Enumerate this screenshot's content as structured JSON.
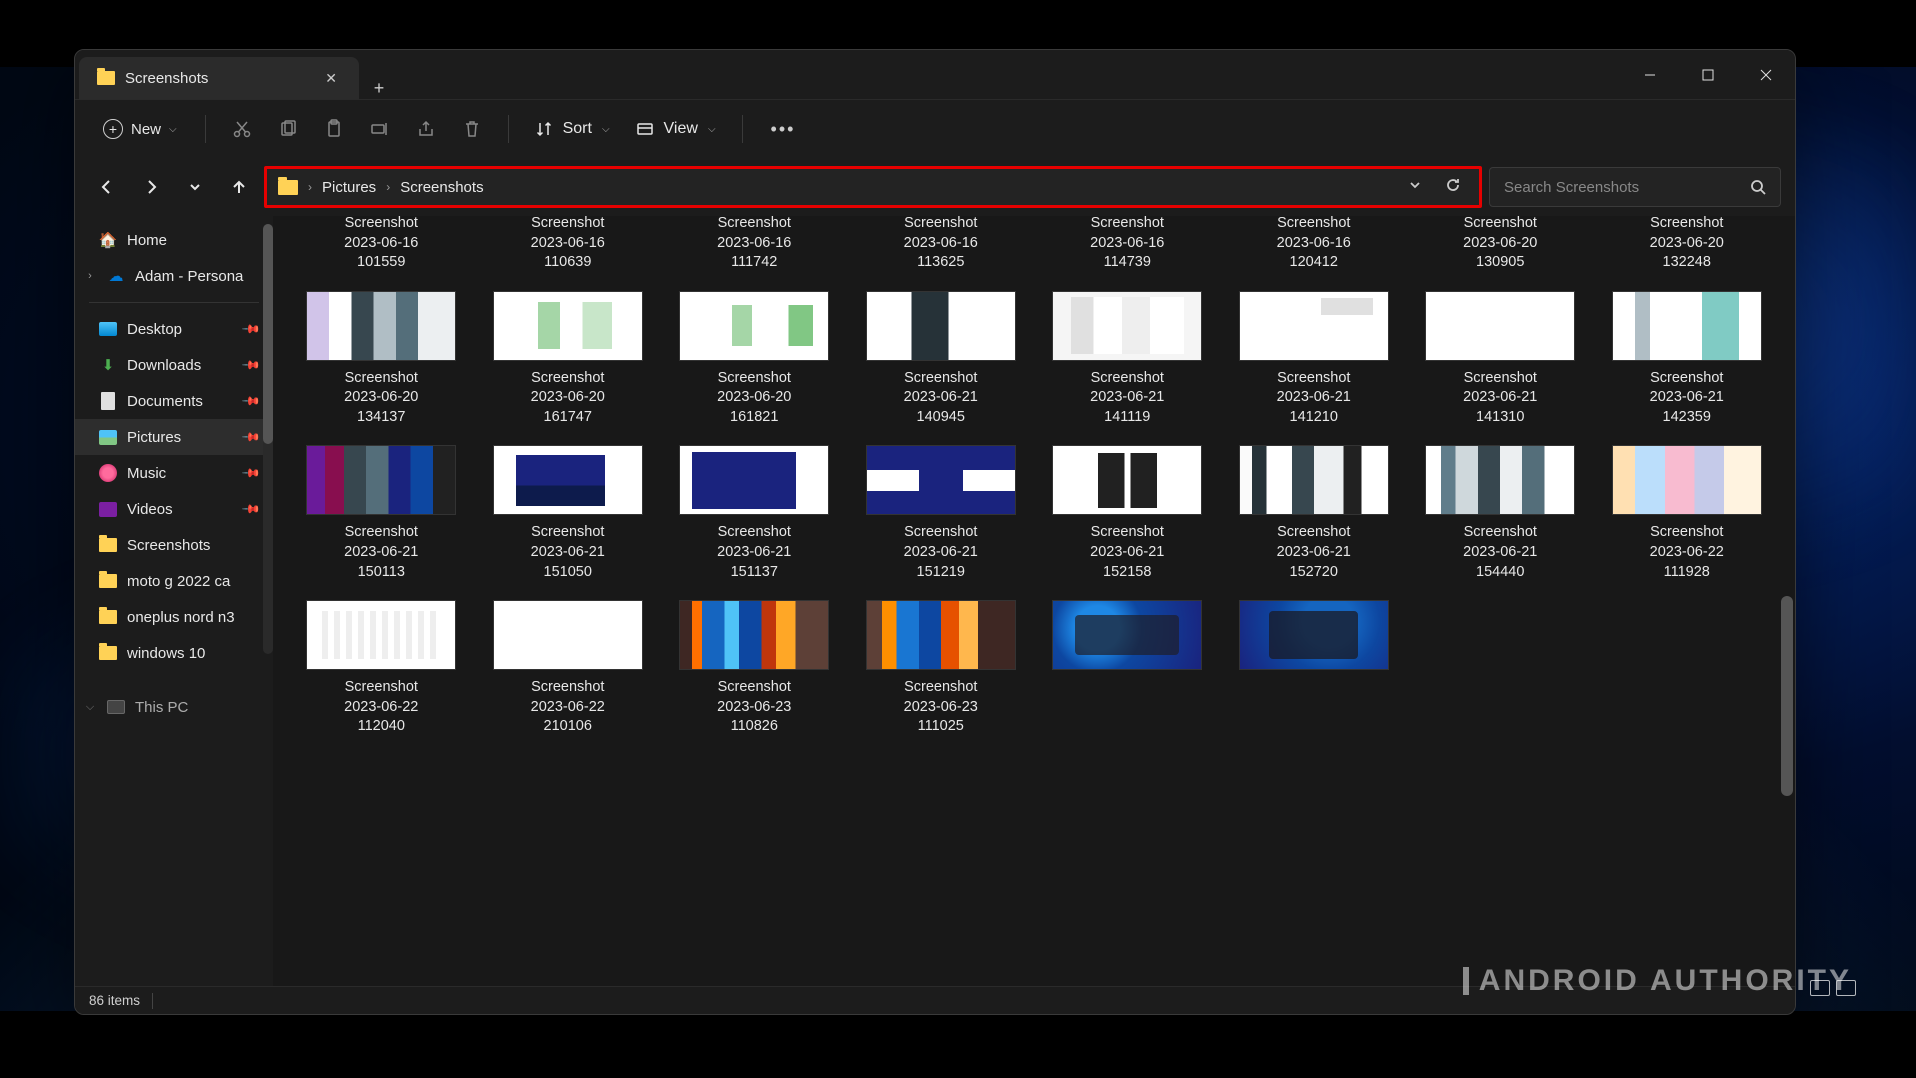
{
  "tab": {
    "title": "Screenshots"
  },
  "toolbar": {
    "new": "New",
    "sort": "Sort",
    "view": "View"
  },
  "breadcrumb": {
    "p1": "Pictures",
    "p2": "Screenshots"
  },
  "search": {
    "placeholder": "Search Screenshots"
  },
  "sidebar": {
    "home": "Home",
    "personal": "Adam - Persona",
    "desktop": "Desktop",
    "downloads": "Downloads",
    "documents": "Documents",
    "pictures": "Pictures",
    "music": "Music",
    "videos": "Videos",
    "screenshots": "Screenshots",
    "motog": "moto g 2022 ca",
    "oneplus": "oneplus nord n3",
    "windows10": "windows 10",
    "thispc": "This PC"
  },
  "files": {
    "r0": [
      {
        "l1": "Screenshot",
        "l2": "2023-06-16",
        "l3": "101559"
      },
      {
        "l1": "Screenshot",
        "l2": "2023-06-16",
        "l3": "110639"
      },
      {
        "l1": "Screenshot",
        "l2": "2023-06-16",
        "l3": "111742"
      },
      {
        "l1": "Screenshot",
        "l2": "2023-06-16",
        "l3": "113625"
      },
      {
        "l1": "Screenshot",
        "l2": "2023-06-16",
        "l3": "114739"
      },
      {
        "l1": "Screenshot",
        "l2": "2023-06-16",
        "l3": "120412"
      },
      {
        "l1": "Screenshot",
        "l2": "2023-06-20",
        "l3": "130905"
      },
      {
        "l1": "Screenshot",
        "l2": "2023-06-20",
        "l3": "132248"
      }
    ],
    "r1": [
      {
        "l1": "Screenshot",
        "l2": "2023-06-20",
        "l3": "134137",
        "th": "th-a"
      },
      {
        "l1": "Screenshot",
        "l2": "2023-06-20",
        "l3": "161747",
        "th": "th-b"
      },
      {
        "l1": "Screenshot",
        "l2": "2023-06-20",
        "l3": "161821",
        "th": "th-c"
      },
      {
        "l1": "Screenshot",
        "l2": "2023-06-21",
        "l3": "140945",
        "th": "th-d"
      },
      {
        "l1": "Screenshot",
        "l2": "2023-06-21",
        "l3": "141119",
        "th": "th-e"
      },
      {
        "l1": "Screenshot",
        "l2": "2023-06-21",
        "l3": "141210",
        "th": "th-f"
      },
      {
        "l1": "Screenshot",
        "l2": "2023-06-21",
        "l3": "141310",
        "th": "th-g"
      },
      {
        "l1": "Screenshot",
        "l2": "2023-06-21",
        "l3": "142359",
        "th": "th-h"
      }
    ],
    "r2": [
      {
        "l1": "Screenshot",
        "l2": "2023-06-21",
        "l3": "150113",
        "th": "th-i"
      },
      {
        "l1": "Screenshot",
        "l2": "2023-06-21",
        "l3": "151050",
        "th": "th-j"
      },
      {
        "l1": "Screenshot",
        "l2": "2023-06-21",
        "l3": "151137",
        "th": "th-k"
      },
      {
        "l1": "Screenshot",
        "l2": "2023-06-21",
        "l3": "151219",
        "th": "th-l"
      },
      {
        "l1": "Screenshot",
        "l2": "2023-06-21",
        "l3": "152158",
        "th": "th-m"
      },
      {
        "l1": "Screenshot",
        "l2": "2023-06-21",
        "l3": "152720",
        "th": "th-n"
      },
      {
        "l1": "Screenshot",
        "l2": "2023-06-21",
        "l3": "154440",
        "th": "th-o"
      },
      {
        "l1": "Screenshot",
        "l2": "2023-06-22",
        "l3": "111928",
        "th": "th-p"
      }
    ],
    "r3": [
      {
        "l1": "Screenshot",
        "l2": "2023-06-22",
        "l3": "112040",
        "th": "th-q"
      },
      {
        "l1": "Screenshot",
        "l2": "2023-06-22",
        "l3": "210106",
        "th": "th-r"
      },
      {
        "l1": "Screenshot",
        "l2": "2023-06-23",
        "l3": "110826",
        "th": "th-s"
      },
      {
        "l1": "Screenshot",
        "l2": "2023-06-23",
        "l3": "111025",
        "th": "th-t"
      },
      {
        "l1": "",
        "l2": "",
        "l3": "",
        "th": "th-u"
      },
      {
        "l1": "",
        "l2": "",
        "l3": "",
        "th": "th-v"
      }
    ]
  },
  "status": {
    "count": "86 items"
  },
  "watermark": "ANDROID AUTHORITY"
}
